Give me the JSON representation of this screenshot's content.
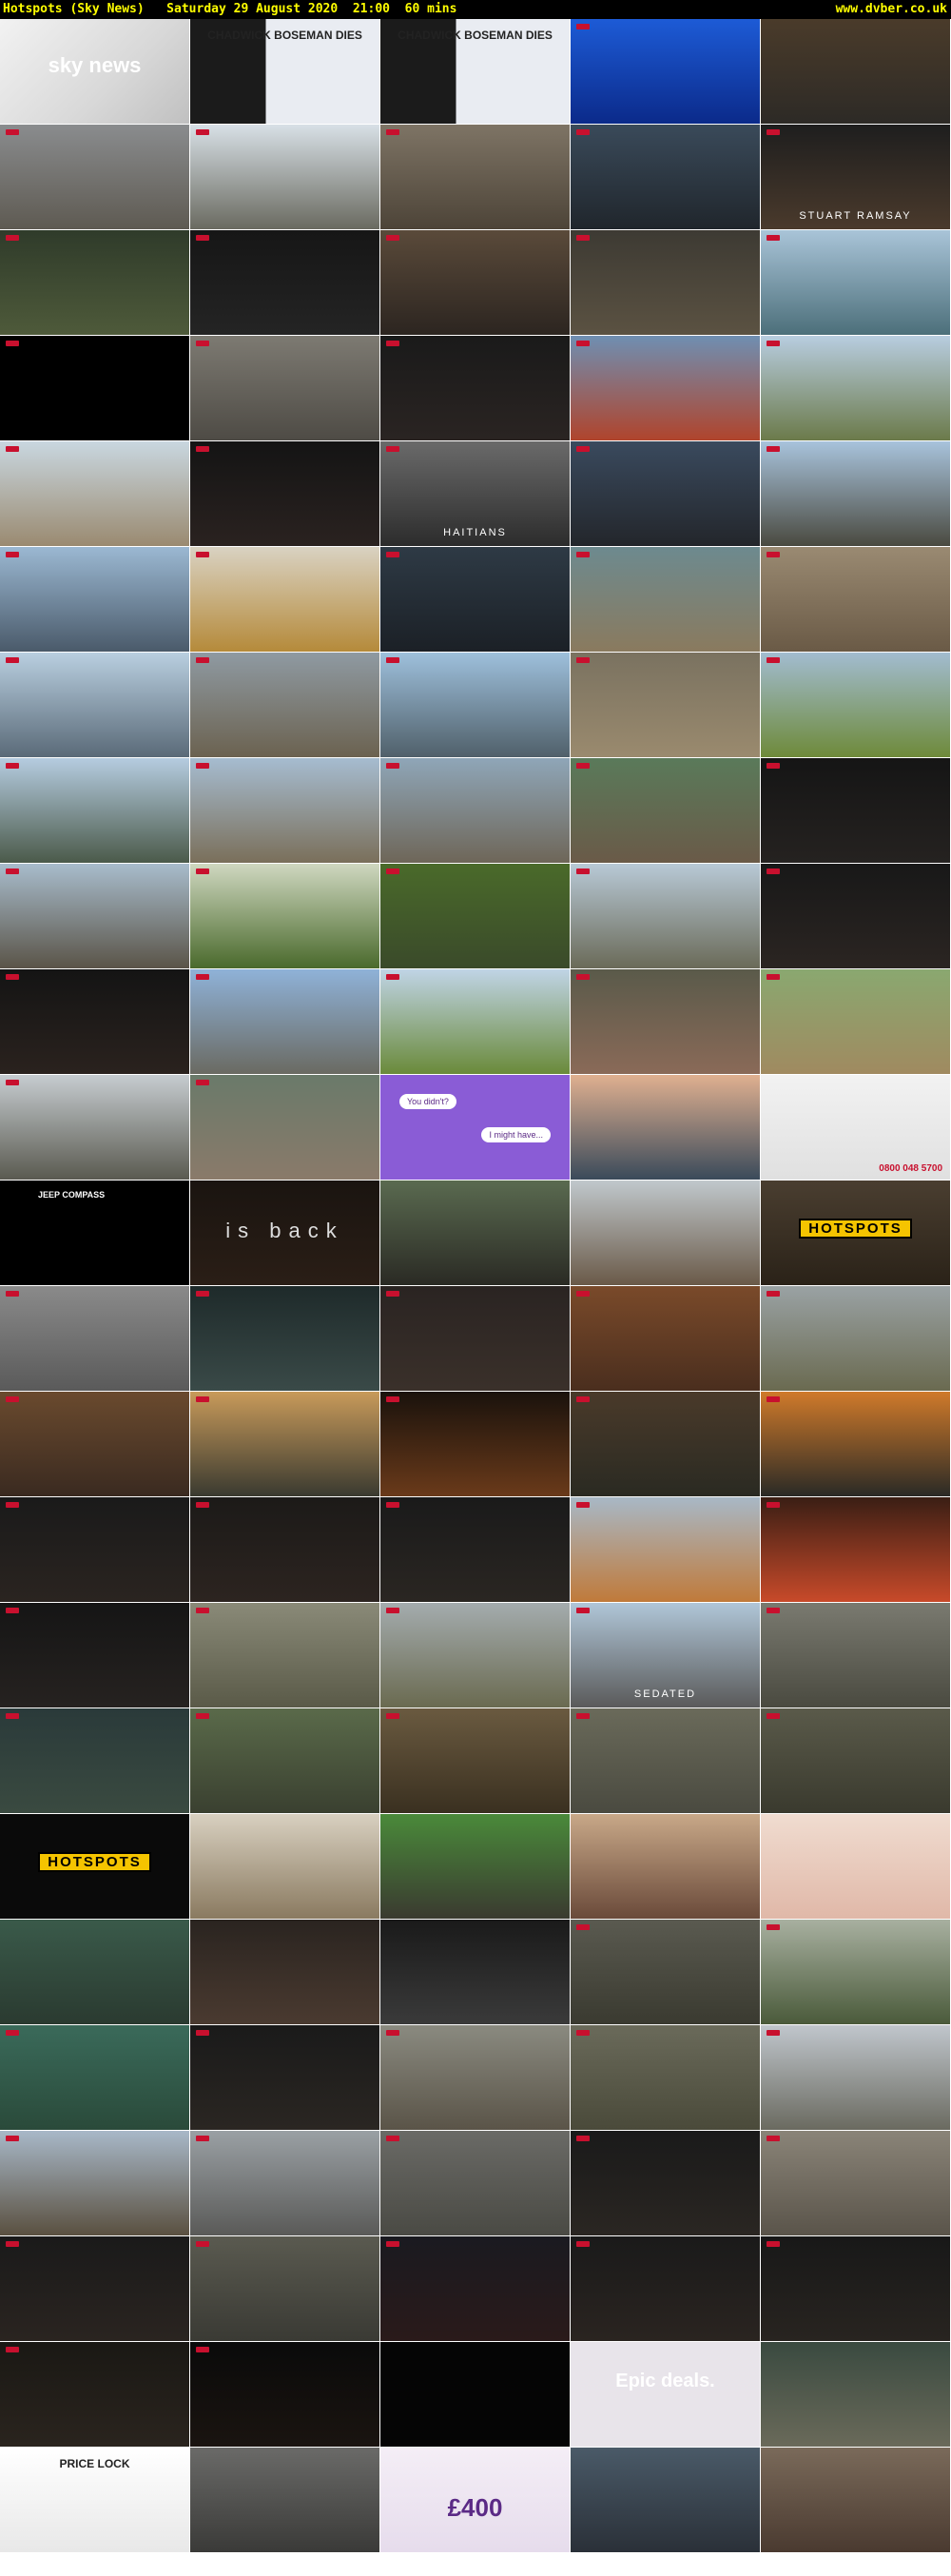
{
  "header": {
    "title": "Hotspots (Sky News)   Saturday 29 August 2020  21:00  60 mins",
    "site": "www.dvber.co.uk"
  },
  "thumbnails": [
    {
      "bg": "linear-gradient(135deg,#f2f2f2,#d8d8d8 60%,#c0c0c0)",
      "caption": "sky news",
      "style": "cap-big",
      "logo": false
    },
    {
      "bg": "linear-gradient(90deg,#1b1b1b 40%,#e9ecf2 40%)",
      "caption": "CHADWICK BOSEMAN DIES",
      "style": "cap-dark",
      "logo": false
    },
    {
      "bg": "linear-gradient(90deg,#1b1b1b 40%,#e9ecf2 40%)",
      "caption": "CHADWICK BOSEMAN DIES",
      "style": "cap-dark",
      "logo": false
    },
    {
      "bg": "linear-gradient(180deg,#1d5bd6,#0b2a8a)",
      "caption": "",
      "style": "",
      "logo": true
    },
    {
      "bg": "linear-gradient(180deg,#4a3b2a,#2d2a26)",
      "caption": "",
      "style": "",
      "logo": false
    },
    {
      "bg": "linear-gradient(180deg,#8a8c8e,#5e5a52)",
      "caption": "",
      "style": "",
      "logo": true
    },
    {
      "bg": "linear-gradient(180deg,#d8e0e6,#6a6a60)",
      "caption": "",
      "style": "",
      "logo": true
    },
    {
      "bg": "linear-gradient(180deg,#7e7465,#4d4438)",
      "caption": "",
      "style": "",
      "logo": true
    },
    {
      "bg": "linear-gradient(180deg,#3a4a5a,#20262c)",
      "caption": "",
      "style": "",
      "logo": true
    },
    {
      "bg": "linear-gradient(180deg,#1e1e1e,#4a3a2c)",
      "caption": "STUART RAMSAY",
      "style": "cap-white",
      "logo": true
    },
    {
      "bg": "linear-gradient(180deg,#2f3b2a,#4e5a3a)",
      "caption": "",
      "style": "",
      "logo": true
    },
    {
      "bg": "linear-gradient(180deg,#161616,#242424)",
      "caption": "",
      "style": "",
      "logo": true
    },
    {
      "bg": "linear-gradient(180deg,#5a4a3a,#2c2520)",
      "caption": "",
      "style": "",
      "logo": true
    },
    {
      "bg": "linear-gradient(180deg,#3d3a33,#5b5242)",
      "caption": "",
      "style": "",
      "logo": true
    },
    {
      "bg": "linear-gradient(180deg,#a9c4d8,#4c6f7a)",
      "caption": "",
      "style": "",
      "logo": true
    },
    {
      "bg": "#000000",
      "caption": "",
      "style": "",
      "logo": true
    },
    {
      "bg": "linear-gradient(180deg,#7d7a72,#4e4b45)",
      "caption": "",
      "style": "",
      "logo": true
    },
    {
      "bg": "linear-gradient(180deg,#1a1a1a,#2a2422)",
      "caption": "",
      "style": "",
      "logo": true
    },
    {
      "bg": "linear-gradient(180deg,#6f8fb2,#b0442c)",
      "caption": "",
      "style": "",
      "logo": true
    },
    {
      "bg": "linear-gradient(180deg,#b8cde0,#6b7a4a)",
      "caption": "",
      "style": "",
      "logo": true
    },
    {
      "bg": "linear-gradient(180deg,#c9d7e0,#9a8a70)",
      "caption": "",
      "style": "",
      "logo": true
    },
    {
      "bg": "linear-gradient(180deg,#141414,#2a2220)",
      "caption": "",
      "style": "",
      "logo": true
    },
    {
      "bg": "linear-gradient(180deg,#6a6a6a,#2c2c2c)",
      "caption": "HAITIANS",
      "style": "cap-white",
      "logo": true
    },
    {
      "bg": "linear-gradient(180deg,#3a4a5e,#23262b)",
      "caption": "",
      "style": "",
      "logo": true
    },
    {
      "bg": "linear-gradient(180deg,#a8c3dc,#4a4a40)",
      "caption": "",
      "style": "",
      "logo": true
    },
    {
      "bg": "linear-gradient(180deg,#9bb8d2,#4a5a6a)",
      "caption": "",
      "style": "",
      "logo": true
    },
    {
      "bg": "linear-gradient(180deg,#d9d2c2,#b58a3a)",
      "caption": "",
      "style": "",
      "logo": true
    },
    {
      "bg": "linear-gradient(180deg,#2e3a45,#1b2026)",
      "caption": "",
      "style": "",
      "logo": true
    },
    {
      "bg": "linear-gradient(180deg,#6d8a8f,#8a7a5e)",
      "caption": "",
      "style": "",
      "logo": true
    },
    {
      "bg": "linear-gradient(180deg,#9a8a72,#6a5a46)",
      "caption": "",
      "style": "",
      "logo": true
    },
    {
      "bg": "linear-gradient(180deg,#b9cfe0,#5a6a78)",
      "caption": "",
      "style": "",
      "logo": true
    },
    {
      "bg": "linear-gradient(180deg,#8f9aa2,#6b6250)",
      "caption": "",
      "style": "",
      "logo": true
    },
    {
      "bg": "linear-gradient(180deg,#9ec0dc,#50606a)",
      "caption": "",
      "style": "",
      "logo": true
    },
    {
      "bg": "linear-gradient(180deg,#7a7260,#9a8a6e)",
      "caption": "",
      "style": "",
      "logo": true
    },
    {
      "bg": "linear-gradient(180deg,#a2bcd0,#6e8a3a)",
      "caption": "",
      "style": "",
      "logo": true
    },
    {
      "bg": "linear-gradient(180deg,#b5cce0,#4b5a4a)",
      "caption": "",
      "style": "",
      "logo": true
    },
    {
      "bg": "linear-gradient(180deg,#a6bcd0,#7a6f5a)",
      "caption": "",
      "style": "",
      "logo": true
    },
    {
      "bg": "linear-gradient(180deg,#8fa6b8,#6e6658)",
      "caption": "",
      "style": "",
      "logo": true
    },
    {
      "bg": "linear-gradient(180deg,#5a7a5a,#6a5a48)",
      "caption": "",
      "style": "",
      "logo": true
    },
    {
      "bg": "linear-gradient(180deg,#151515,#252220)",
      "caption": "",
      "style": "",
      "logo": true
    },
    {
      "bg": "linear-gradient(180deg,#a8bccc,#5a5448)",
      "caption": "",
      "style": "",
      "logo": true
    },
    {
      "bg": "linear-gradient(180deg,#cfd8c0,#4a6a2c)",
      "caption": "",
      "style": "",
      "logo": true
    },
    {
      "bg": "linear-gradient(180deg,#4a6a2a,#3a4a2a)",
      "caption": "",
      "style": "",
      "logo": true
    },
    {
      "bg": "linear-gradient(180deg,#b8c9d6,#6a6a58)",
      "caption": "",
      "style": "",
      "logo": true
    },
    {
      "bg": "linear-gradient(180deg,#181818,#2b2522)",
      "caption": "",
      "style": "",
      "logo": true
    },
    {
      "bg": "linear-gradient(180deg,#141414,#2a221e)",
      "caption": "",
      "style": "",
      "logo": true
    },
    {
      "bg": "linear-gradient(180deg,#8fb2d8,#6a6a62)",
      "caption": "",
      "style": "",
      "logo": true
    },
    {
      "bg": "linear-gradient(180deg,#c0d4e6,#6a8a3a)",
      "caption": "",
      "style": "",
      "logo": true
    },
    {
      "bg": "linear-gradient(180deg,#5a5a4a,#8a6a58)",
      "caption": "",
      "style": "",
      "logo": true
    },
    {
      "bg": "linear-gradient(180deg,#8aa870,#a08a60)",
      "caption": "",
      "style": "",
      "logo": true
    },
    {
      "bg": "linear-gradient(180deg,#c6ccd0,#5a5a50)",
      "caption": "",
      "style": "",
      "logo": true
    },
    {
      "bg": "linear-gradient(180deg,#6a7a6a,#8a7a6a)",
      "caption": "",
      "style": "",
      "logo": true
    },
    {
      "bg": "#8a5cd6",
      "caption": "You didn't?",
      "style": "cap-bubble",
      "logo": false,
      "caption2": "I might have...",
      "style2": "cap-bubble2"
    },
    {
      "bg": "linear-gradient(180deg,#e0b090,#3a4a5a)",
      "caption": "",
      "style": "",
      "logo": false
    },
    {
      "bg": "linear-gradient(180deg,#f2f2f2,#e0e0e0)",
      "caption": "0800 048 5700",
      "style": "cap-phone",
      "logo": false
    },
    {
      "bg": "#000000",
      "caption": "JEEP COMPASS",
      "style": "cap-jeep",
      "logo": false
    },
    {
      "bg": "linear-gradient(180deg,#1a1410,#2a1e16)",
      "caption": "is back",
      "style": "cap-thin",
      "logo": false
    },
    {
      "bg": "linear-gradient(180deg,#5a6a50,#2a2a24)",
      "caption": "",
      "style": "",
      "logo": false
    },
    {
      "bg": "linear-gradient(180deg,#c0c8cc,#6a5a48)",
      "caption": "",
      "style": "",
      "logo": false
    },
    {
      "bg": "linear-gradient(180deg,#4a3e30,#2a2218)",
      "caption": "HOTSPOTS",
      "style": "cap-yellow",
      "logo": false
    },
    {
      "bg": "linear-gradient(180deg,#8a8a8a,#5a5a5a)",
      "caption": "",
      "style": "",
      "logo": true
    },
    {
      "bg": "linear-gradient(180deg,#1e2a2a,#3a4a48)",
      "caption": "",
      "style": "",
      "logo": true
    },
    {
      "bg": "linear-gradient(180deg,#2a2422,#3a302a)",
      "caption": "",
      "style": "",
      "logo": true
    },
    {
      "bg": "linear-gradient(180deg,#7a4a2a,#4a2e1e)",
      "caption": "",
      "style": "",
      "logo": true
    },
    {
      "bg": "linear-gradient(180deg,#9aa2a4,#6a6a50)",
      "caption": "",
      "style": "",
      "logo": true
    },
    {
      "bg": "linear-gradient(180deg,#6a4a2e,#3a2a20)",
      "caption": "",
      "style": "",
      "logo": true
    },
    {
      "bg": "linear-gradient(180deg,#c89a5a,#3a3a30)",
      "caption": "",
      "style": "",
      "logo": true
    },
    {
      "bg": "linear-gradient(180deg,#1a120c,#6a3a1a)",
      "caption": "",
      "style": "",
      "logo": true
    },
    {
      "bg": "linear-gradient(180deg,#4a3a2a,#2a2a22)",
      "caption": "",
      "style": "",
      "logo": true
    },
    {
      "bg": "linear-gradient(180deg,#d07a2a,#2a2a26)",
      "caption": "",
      "style": "",
      "logo": true
    },
    {
      "bg": "linear-gradient(180deg,#1a1a1a,#2a2420)",
      "caption": "",
      "style": "",
      "logo": true
    },
    {
      "bg": "linear-gradient(180deg,#1c1a18,#2c2420)",
      "caption": "",
      "style": "",
      "logo": true
    },
    {
      "bg": "linear-gradient(180deg,#1a1a1a,#2a2622)",
      "caption": "",
      "style": "",
      "logo": true
    },
    {
      "bg": "linear-gradient(180deg,#a8b8c6,#c07a3a)",
      "caption": "",
      "style": "",
      "logo": true
    },
    {
      "bg": "linear-gradient(180deg,#3a1e14,#c84a2a)",
      "caption": "",
      "style": "",
      "logo": true
    },
    {
      "bg": "linear-gradient(180deg,#151515,#262220)",
      "caption": "",
      "style": "",
      "logo": true
    },
    {
      "bg": "linear-gradient(180deg,#8a8a78,#5a5a48)",
      "caption": "",
      "style": "",
      "logo": true
    },
    {
      "bg": "linear-gradient(180deg,#a4acae,#6a6a50)",
      "caption": "",
      "style": "",
      "logo": true
    },
    {
      "bg": "linear-gradient(180deg,#b0c6d8,#5a5a5a)",
      "caption": "SEDATED",
      "style": "cap-white",
      "logo": true
    },
    {
      "bg": "linear-gradient(180deg,#7a7a70,#4a4a40)",
      "caption": "",
      "style": "",
      "logo": true
    },
    {
      "bg": "linear-gradient(180deg,#2a3a3a,#3a4a40)",
      "caption": "",
      "style": "",
      "logo": true
    },
    {
      "bg": "linear-gradient(180deg,#5a6a4a,#3a4030)",
      "caption": "",
      "style": "",
      "logo": true
    },
    {
      "bg": "linear-gradient(180deg,#6a5a40,#3a3020)",
      "caption": "",
      "style": "",
      "logo": true
    },
    {
      "bg": "linear-gradient(180deg,#6a6a5a,#4a4a40)",
      "caption": "",
      "style": "",
      "logo": true
    },
    {
      "bg": "linear-gradient(180deg,#5a5a4a,#3a3a2e)",
      "caption": "",
      "style": "",
      "logo": true
    },
    {
      "bg": "#0a0a0a",
      "caption": "HOTSPOTS",
      "style": "cap-yellow",
      "logo": false
    },
    {
      "bg": "linear-gradient(180deg,#d8d0c0,#8a7a60)",
      "caption": "",
      "style": "",
      "logo": false
    },
    {
      "bg": "linear-gradient(180deg,#4a8a3a,#3a3a30)",
      "caption": "",
      "style": "",
      "logo": false
    },
    {
      "bg": "linear-gradient(180deg,#c8a888,#6a4a3a)",
      "caption": "",
      "style": "",
      "logo": false
    },
    {
      "bg": "linear-gradient(180deg,#f0dcd0,#e0b8a8)",
      "caption": "",
      "style": "",
      "logo": false
    },
    {
      "bg": "linear-gradient(180deg,#3a5a4a,#2a3a30)",
      "caption": "",
      "style": "",
      "logo": false
    },
    {
      "bg": "linear-gradient(180deg,#2a2420,#4a3a30)",
      "caption": "",
      "style": "",
      "logo": false
    },
    {
      "bg": "linear-gradient(180deg,#1a1a1a,#3a3a3a)",
      "caption": "",
      "style": "",
      "logo": false
    },
    {
      "bg": "linear-gradient(180deg,#5a5a50,#3a3a30)",
      "caption": "",
      "style": "",
      "logo": true
    },
    {
      "bg": "linear-gradient(180deg,#a8b0a0,#4a5a3a)",
      "caption": "",
      "style": "",
      "logo": true
    },
    {
      "bg": "linear-gradient(180deg,#3a6a5a,#2a4a3a)",
      "caption": "",
      "style": "",
      "logo": true
    },
    {
      "bg": "linear-gradient(180deg,#1a1a1a,#2a2622)",
      "caption": "",
      "style": "",
      "logo": true
    },
    {
      "bg": "linear-gradient(180deg,#8a8a80,#5a5448)",
      "caption": "",
      "style": "",
      "logo": true
    },
    {
      "bg": "linear-gradient(180deg,#6a6a5a,#4a4a3a)",
      "caption": "",
      "style": "",
      "logo": true
    },
    {
      "bg": "linear-gradient(180deg,#c0c6cc,#6a6a60)",
      "caption": "",
      "style": "",
      "logo": true
    },
    {
      "bg": "linear-gradient(180deg,#a8b8c8,#5a5040)",
      "caption": "",
      "style": "",
      "logo": true
    },
    {
      "bg": "linear-gradient(180deg,#9aa0a4,#5a5a58)",
      "caption": "",
      "style": "",
      "logo": true
    },
    {
      "bg": "linear-gradient(180deg,#6a6a66,#4a4a44)",
      "caption": "",
      "style": "",
      "logo": true
    },
    {
      "bg": "linear-gradient(180deg,#1a1a1a,#2a2622)",
      "caption": "",
      "style": "",
      "logo": true
    },
    {
      "bg": "linear-gradient(180deg,#8a8478,#5a544a)",
      "caption": "",
      "style": "",
      "logo": true
    },
    {
      "bg": "linear-gradient(180deg,#1a1a1a,#2a2420)",
      "caption": "",
      "style": "",
      "logo": true
    },
    {
      "bg": "linear-gradient(180deg,#5a5a50,#3a3a34)",
      "caption": "",
      "style": "",
      "logo": true
    },
    {
      "bg": "linear-gradient(180deg,#1a1a20,#2a1a1a)",
      "caption": "",
      "style": "",
      "logo": true
    },
    {
      "bg": "linear-gradient(180deg,#1a1a1a,#2a2420)",
      "caption": "",
      "style": "",
      "logo": true
    },
    {
      "bg": "linear-gradient(180deg,#181818,#282420)",
      "caption": "",
      "style": "",
      "logo": true
    },
    {
      "bg": "linear-gradient(180deg,#1a1814,#2a241e)",
      "caption": "",
      "style": "",
      "logo": true
    },
    {
      "bg": "linear-gradient(180deg,#0a0a0a,#1a1410)",
      "caption": "",
      "style": "",
      "logo": true
    },
    {
      "bg": "#050505",
      "caption": "",
      "style": "",
      "logo": false
    },
    {
      "bg": "#e8e4ea",
      "caption": "Epic deals.",
      "style": "cap-ad",
      "logo": false
    },
    {
      "bg": "linear-gradient(180deg,#3a4a40,#6a6a5a)",
      "caption": "",
      "style": "",
      "logo": false
    },
    {
      "bg": "linear-gradient(180deg,#ffffff,#e8e8e8)",
      "caption": "PRICE LOCK",
      "style": "cap-dark",
      "logo": false
    },
    {
      "bg": "linear-gradient(180deg,#6a6a68,#3a3a38)",
      "caption": "",
      "style": "",
      "logo": false
    },
    {
      "bg": "linear-gradient(180deg,#f4eef6,#e6dcec)",
      "caption": "£400",
      "style": "cap-price",
      "logo": false
    },
    {
      "bg": "linear-gradient(180deg,#4a5a68,#2a3038)",
      "caption": "",
      "style": "",
      "logo": false
    },
    {
      "bg": "linear-gradient(180deg,#7a6a5a,#4a3a30)",
      "caption": "",
      "style": "",
      "logo": false
    }
  ]
}
